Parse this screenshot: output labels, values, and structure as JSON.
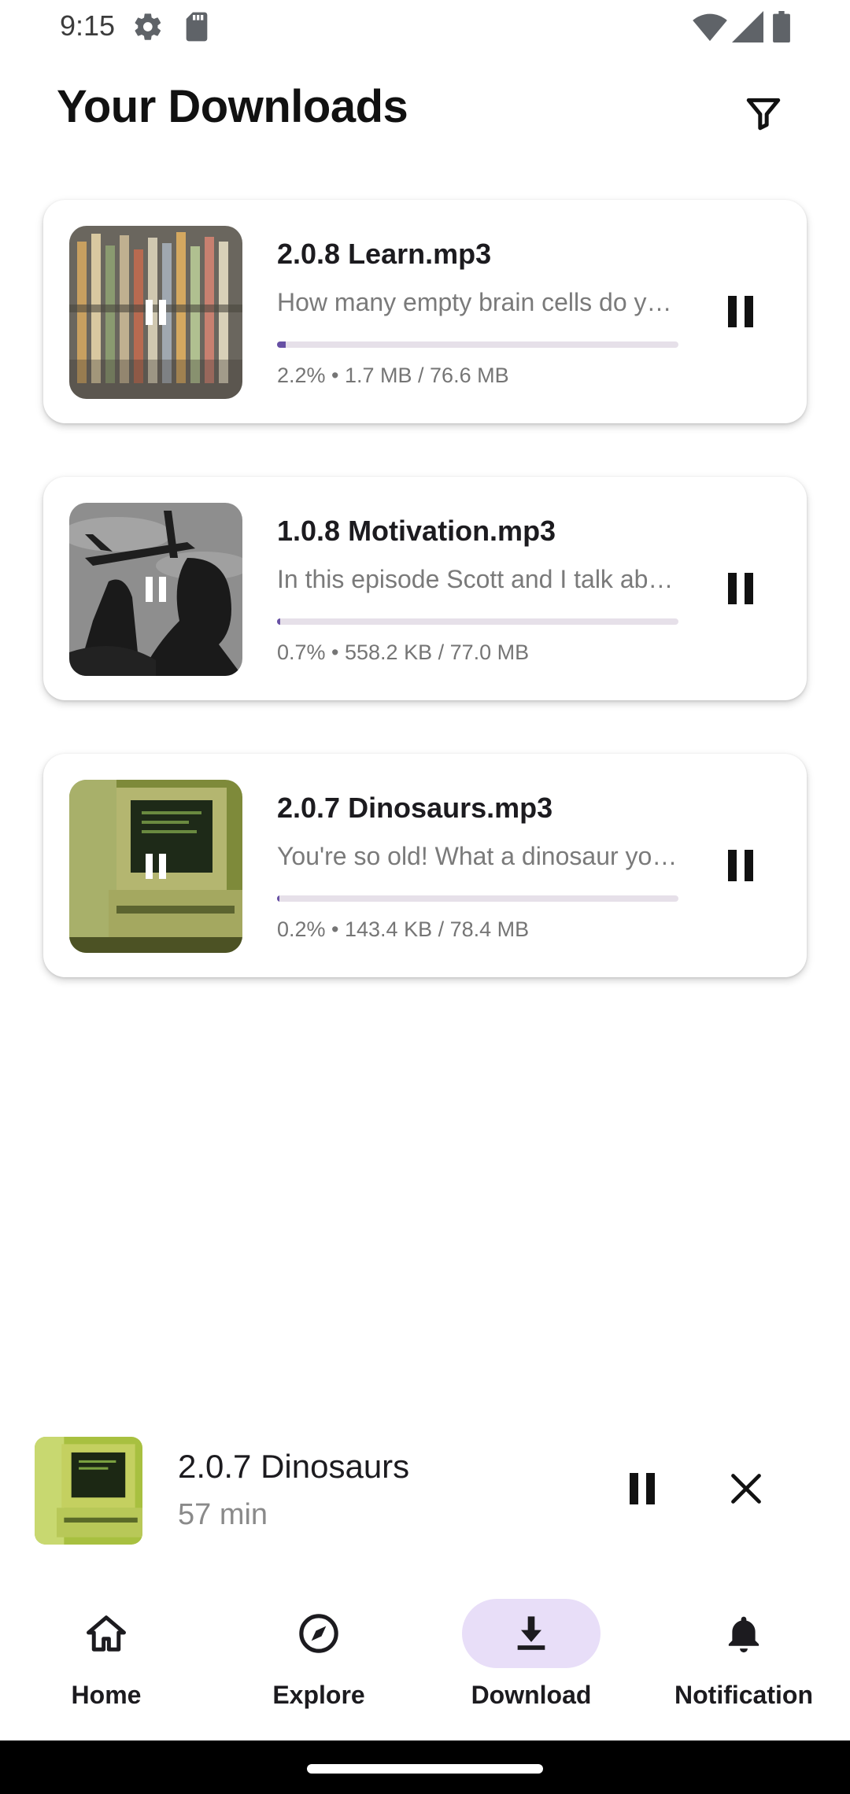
{
  "status_bar": {
    "time": "9:15",
    "icons": [
      "settings-icon",
      "sd-card-icon",
      "wifi-icon",
      "signal-icon",
      "battery-icon"
    ]
  },
  "header": {
    "title": "Your Downloads",
    "filter_icon": "filter-icon"
  },
  "downloads": [
    {
      "title": "2.0.8 Learn.mp3",
      "description": "How many empty brain cells do you have left?",
      "progress_percent": 2.2,
      "meta": "2.2% • 1.7 MB / 76.6 MB",
      "thumbnail": "pencils"
    },
    {
      "title": "1.0.8 Motivation.mp3",
      "description": "In this episode Scott and I talk about motivation",
      "progress_percent": 0.7,
      "meta": "0.7% • 558.2 KB / 77.0 MB",
      "thumbnail": "silhouette-airplane"
    },
    {
      "title": "2.0.7 Dinosaurs.mp3",
      "description": "You're so old! What a dinosaur you are",
      "progress_percent": 0.2,
      "meta": "0.2% • 143.4 KB / 78.4 MB",
      "thumbnail": "old-computer"
    }
  ],
  "mini_player": {
    "title": "2.0.7 Dinosaurs",
    "duration": "57 min"
  },
  "bottom_nav": {
    "items": [
      {
        "label": "Home",
        "icon": "home-icon",
        "active": false
      },
      {
        "label": "Explore",
        "icon": "compass-icon",
        "active": false
      },
      {
        "label": "Download",
        "icon": "download-icon",
        "active": true
      },
      {
        "label": "Notification",
        "icon": "bell-icon",
        "active": false
      }
    ]
  },
  "colors": {
    "accent": "#6750a4",
    "nav_active_bg": "#e8def8",
    "track": "#e6e0e9"
  }
}
